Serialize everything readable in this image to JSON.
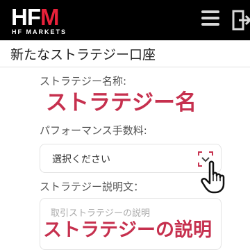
{
  "header": {
    "logo_main_prefix": "HF",
    "logo_main_accent": "M",
    "logo_sub": "HF MARKETS",
    "menu_icon": "hamburger-menu-icon",
    "logout_icon": "logout-icon",
    "background_color": "#000000",
    "brand_accent": "#e8213a"
  },
  "page": {
    "title": "新たなストラテジー口座"
  },
  "form": {
    "strategy_name": {
      "label": "ストラテジー名称:",
      "annotation": "ストラテジー名"
    },
    "performance_fee": {
      "label": "パフォーマンス手数料:",
      "selected_value": "選択ください",
      "chevron_icon": "chevron-down-icon"
    },
    "strategy_description": {
      "label": "ストラテジー説明文：",
      "placeholder": "取引ストラテジーの説明",
      "annotation": "ストラテジーの説明"
    },
    "annotation_color": "#c6304e"
  },
  "cursor": {
    "icon": "hand-pointer-icon"
  }
}
